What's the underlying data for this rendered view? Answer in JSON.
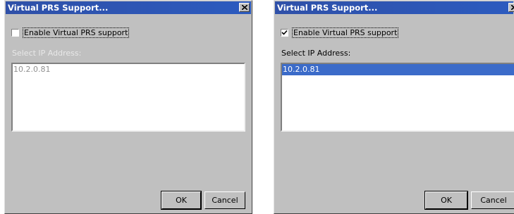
{
  "dialogs": [
    {
      "title": "Virtual PRS Support...",
      "enable_label": "Enable Virtual PRS support",
      "enable_checked": false,
      "select_label": "Select IP Address:",
      "list_items": [
        "10.2.0.81"
      ],
      "selected_item": null,
      "ok_label": "OK",
      "cancel_label": "Cancel"
    },
    {
      "title": "Virtual PRS Support...",
      "enable_label": "Enable Virtual PRS support",
      "enable_checked": true,
      "select_label": "Select IP Address:",
      "list_items": [
        "10.2.0.81"
      ],
      "selected_item": "10.2.0.81",
      "ok_label": "OK",
      "cancel_label": "Cancel"
    }
  ],
  "colors": {
    "titlebar": "#2c5bbf",
    "dialog_bg": "#c0c0c0",
    "selection": "#3b6bc9"
  },
  "icons": {
    "close": "close-icon",
    "check": "checkmark-icon"
  }
}
